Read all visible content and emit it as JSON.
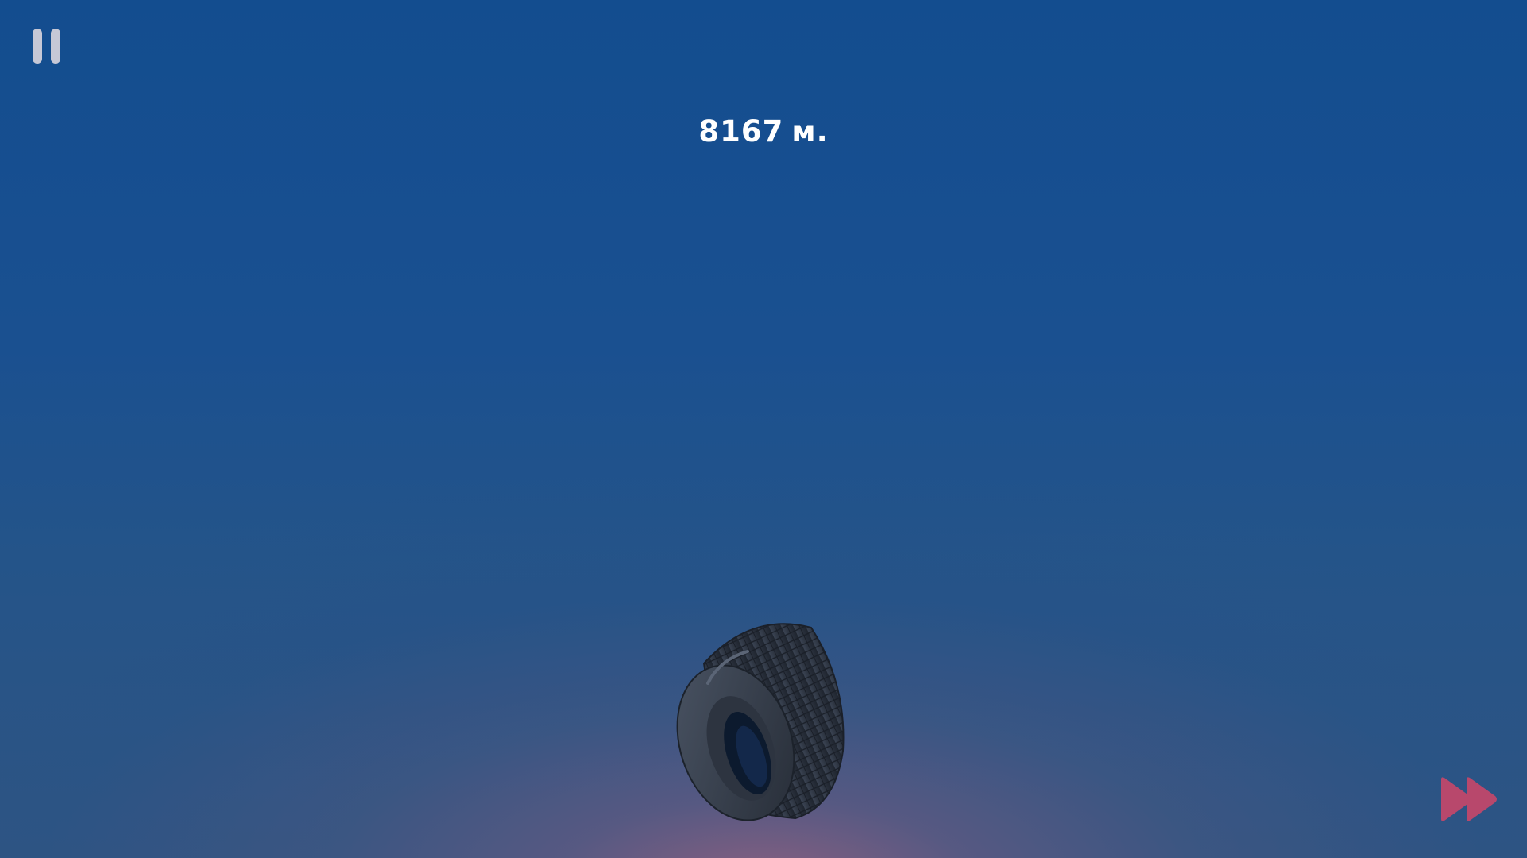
{
  "hud": {
    "distance_value": "8167",
    "distance_unit": "м."
  },
  "controls": {
    "pause_icon": "pause-icon",
    "fast_forward_icon": "fast-forward-icon"
  },
  "colors": {
    "sky_top": "#134d8f",
    "sky_horizon_glow": "#8c6080",
    "pause_icon": "#c6c8d6",
    "fast_forward_icon": "#b8486c",
    "distance_text": "#ffffff"
  },
  "scene": {
    "object": "tire"
  }
}
